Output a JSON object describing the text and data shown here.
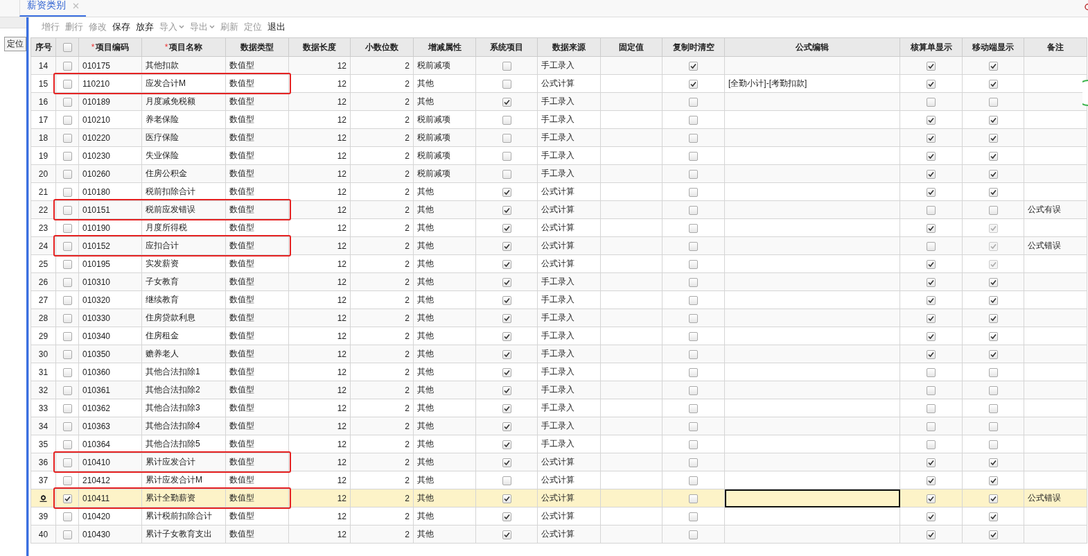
{
  "tabs": [
    {
      "label": "薪资类别",
      "selected": true,
      "closable": true
    }
  ],
  "side_panel": {
    "button": "定位"
  },
  "toolbar": [
    {
      "label": "增行",
      "disabled": true,
      "dropdown": false
    },
    {
      "label": "删行",
      "disabled": true,
      "dropdown": false
    },
    {
      "label": "修改",
      "disabled": true,
      "dropdown": false
    },
    {
      "label": "保存",
      "disabled": false,
      "dropdown": false
    },
    {
      "label": "放弃",
      "disabled": false,
      "dropdown": false
    },
    {
      "label": "导入",
      "disabled": true,
      "dropdown": true
    },
    {
      "label": "导出",
      "disabled": true,
      "dropdown": true
    },
    {
      "label": "刷新",
      "disabled": true,
      "dropdown": false
    },
    {
      "label": "定位",
      "disabled": true,
      "dropdown": false
    },
    {
      "label": "退出",
      "disabled": false,
      "dropdown": false
    }
  ],
  "table": {
    "header_checked": false,
    "columns": [
      {
        "label": "序号"
      },
      {
        "kind": "checkbox"
      },
      {
        "marker": "*",
        "label": "项目编码"
      },
      {
        "marker": "*",
        "label": "项目名称"
      },
      {
        "label": "数据类型"
      },
      {
        "label": "数据长度"
      },
      {
        "label": "小数位数"
      },
      {
        "label": "增减属性"
      },
      {
        "label": "系统项目"
      },
      {
        "label": "数据来源"
      },
      {
        "label": "固定值"
      },
      {
        "label": "复制时清空"
      },
      {
        "label": "公式编辑"
      },
      {
        "label": "核算单显示"
      },
      {
        "label": "移动端显示"
      },
      {
        "label": "备注"
      }
    ],
    "rows": [
      {
        "seq": "14",
        "checked": false,
        "selected": false,
        "code": "010175",
        "name": "其他扣款",
        "type": "数值型",
        "length": "12",
        "decimals": "2",
        "attr": "税前减项",
        "system": false,
        "source": "手工录入",
        "clear": true,
        "account": true,
        "mobile": true,
        "mobile_disabled": false,
        "editing": false
      },
      {
        "seq": "15",
        "checked": false,
        "selected": false,
        "code": "110210",
        "name": "应发合计M",
        "type": "数值型",
        "length": "12",
        "decimals": "2",
        "attr": "其他",
        "system": false,
        "source": "公式计算",
        "clear": true,
        "formula": "[全勤小计]-[考勤扣款]",
        "account": true,
        "mobile": true,
        "mobile_disabled": false,
        "editing": false,
        "flagged": true
      },
      {
        "seq": "16",
        "checked": false,
        "selected": false,
        "code": "010189",
        "name": "月度减免税额",
        "type": "数值型",
        "length": "12",
        "decimals": "2",
        "attr": "其他",
        "system": true,
        "source": "手工录入",
        "clear": false,
        "account": false,
        "mobile": false,
        "mobile_disabled": false,
        "editing": false
      },
      {
        "seq": "17",
        "checked": false,
        "selected": false,
        "code": "010210",
        "name": "养老保险",
        "type": "数值型",
        "length": "12",
        "decimals": "2",
        "attr": "税前减项",
        "system": false,
        "source": "手工录入",
        "clear": false,
        "account": true,
        "mobile": true,
        "mobile_disabled": false,
        "editing": false
      },
      {
        "seq": "18",
        "checked": false,
        "selected": false,
        "code": "010220",
        "name": "医疗保险",
        "type": "数值型",
        "length": "12",
        "decimals": "2",
        "attr": "税前减项",
        "system": false,
        "source": "手工录入",
        "clear": false,
        "account": true,
        "mobile": true,
        "mobile_disabled": false,
        "editing": false
      },
      {
        "seq": "19",
        "checked": false,
        "selected": false,
        "code": "010230",
        "name": "失业保险",
        "type": "数值型",
        "length": "12",
        "decimals": "2",
        "attr": "税前减项",
        "system": false,
        "source": "手工录入",
        "clear": false,
        "account": true,
        "mobile": true,
        "mobile_disabled": false,
        "editing": false
      },
      {
        "seq": "20",
        "checked": false,
        "selected": false,
        "code": "010260",
        "name": "住房公积金",
        "type": "数值型",
        "length": "12",
        "decimals": "2",
        "attr": "税前减项",
        "system": false,
        "source": "手工录入",
        "clear": false,
        "account": true,
        "mobile": true,
        "mobile_disabled": false,
        "editing": false
      },
      {
        "seq": "21",
        "checked": false,
        "selected": false,
        "code": "010180",
        "name": "税前扣除合计",
        "type": "数值型",
        "length": "12",
        "decimals": "2",
        "attr": "其他",
        "system": true,
        "source": "公式计算",
        "clear": false,
        "account": true,
        "mobile": true,
        "mobile_disabled": false,
        "editing": false
      },
      {
        "seq": "22",
        "checked": false,
        "selected": false,
        "code": "010151",
        "name": "税前应发错误",
        "type": "数值型",
        "length": "12",
        "decimals": "2",
        "attr": "其他",
        "system": true,
        "source": "公式计算",
        "clear": false,
        "account": false,
        "mobile": false,
        "mobile_disabled": false,
        "editing": false,
        "note": "公式有误",
        "flagged": true
      },
      {
        "seq": "23",
        "checked": false,
        "selected": false,
        "code": "010190",
        "name": "月度所得税",
        "type": "数值型",
        "length": "12",
        "decimals": "2",
        "attr": "其他",
        "system": true,
        "source": "公式计算",
        "clear": false,
        "account": true,
        "mobile": true,
        "mobile_disabled": true,
        "editing": false
      },
      {
        "seq": "24",
        "checked": false,
        "selected": false,
        "code": "010152",
        "name": "应扣合计",
        "type": "数值型",
        "length": "12",
        "decimals": "2",
        "attr": "其他",
        "system": true,
        "source": "公式计算",
        "clear": false,
        "account": false,
        "mobile": true,
        "mobile_disabled": true,
        "editing": false,
        "note": "公式错误",
        "flagged": true
      },
      {
        "seq": "25",
        "checked": false,
        "selected": false,
        "code": "010195",
        "name": "实发薪资",
        "type": "数值型",
        "length": "12",
        "decimals": "2",
        "attr": "其他",
        "system": true,
        "source": "公式计算",
        "clear": false,
        "account": true,
        "mobile": true,
        "mobile_disabled": true,
        "editing": false
      },
      {
        "seq": "26",
        "checked": false,
        "selected": false,
        "code": "010310",
        "name": "子女教育",
        "type": "数值型",
        "length": "12",
        "decimals": "2",
        "attr": "其他",
        "system": true,
        "source": "手工录入",
        "clear": false,
        "account": true,
        "mobile": true,
        "mobile_disabled": false,
        "editing": false
      },
      {
        "seq": "27",
        "checked": false,
        "selected": false,
        "code": "010320",
        "name": "继续教育",
        "type": "数值型",
        "length": "12",
        "decimals": "2",
        "attr": "其他",
        "system": true,
        "source": "手工录入",
        "clear": false,
        "account": true,
        "mobile": true,
        "mobile_disabled": false,
        "editing": false
      },
      {
        "seq": "28",
        "checked": false,
        "selected": false,
        "code": "010330",
        "name": "住房贷款利息",
        "type": "数值型",
        "length": "12",
        "decimals": "2",
        "attr": "其他",
        "system": true,
        "source": "手工录入",
        "clear": false,
        "account": true,
        "mobile": true,
        "mobile_disabled": false,
        "editing": false
      },
      {
        "seq": "29",
        "checked": false,
        "selected": false,
        "code": "010340",
        "name": "住房租金",
        "type": "数值型",
        "length": "12",
        "decimals": "2",
        "attr": "其他",
        "system": true,
        "source": "手工录入",
        "clear": false,
        "account": true,
        "mobile": true,
        "mobile_disabled": false,
        "editing": false
      },
      {
        "seq": "30",
        "checked": false,
        "selected": false,
        "code": "010350",
        "name": "赡养老人",
        "type": "数值型",
        "length": "12",
        "decimals": "2",
        "attr": "其他",
        "system": true,
        "source": "手工录入",
        "clear": false,
        "account": true,
        "mobile": true,
        "mobile_disabled": false,
        "editing": false
      },
      {
        "seq": "31",
        "checked": false,
        "selected": false,
        "code": "010360",
        "name": "其他合法扣除1",
        "type": "数值型",
        "length": "12",
        "decimals": "2",
        "attr": "其他",
        "system": true,
        "source": "手工录入",
        "clear": false,
        "account": false,
        "mobile": false,
        "mobile_disabled": false,
        "editing": false
      },
      {
        "seq": "32",
        "checked": false,
        "selected": false,
        "code": "010361",
        "name": "其他合法扣除2",
        "type": "数值型",
        "length": "12",
        "decimals": "2",
        "attr": "其他",
        "system": true,
        "source": "手工录入",
        "clear": false,
        "account": false,
        "mobile": false,
        "mobile_disabled": false,
        "editing": false
      },
      {
        "seq": "33",
        "checked": false,
        "selected": false,
        "code": "010362",
        "name": "其他合法扣除3",
        "type": "数值型",
        "length": "12",
        "decimals": "2",
        "attr": "其他",
        "system": true,
        "source": "手工录入",
        "clear": false,
        "account": false,
        "mobile": false,
        "mobile_disabled": false,
        "editing": false
      },
      {
        "seq": "34",
        "checked": false,
        "selected": false,
        "code": "010363",
        "name": "其他合法扣除4",
        "type": "数值型",
        "length": "12",
        "decimals": "2",
        "attr": "其他",
        "system": true,
        "source": "手工录入",
        "clear": false,
        "account": false,
        "mobile": false,
        "mobile_disabled": false,
        "editing": false
      },
      {
        "seq": "35",
        "checked": false,
        "selected": false,
        "code": "010364",
        "name": "其他合法扣除5",
        "type": "数值型",
        "length": "12",
        "decimals": "2",
        "attr": "其他",
        "system": true,
        "source": "手工录入",
        "clear": false,
        "account": false,
        "mobile": false,
        "mobile_disabled": false,
        "editing": false
      },
      {
        "seq": "36",
        "checked": false,
        "selected": false,
        "code": "010410",
        "name": "累计应发合计",
        "type": "数值型",
        "length": "12",
        "decimals": "2",
        "attr": "其他",
        "system": true,
        "source": "公式计算",
        "clear": false,
        "account": true,
        "mobile": true,
        "mobile_disabled": false,
        "editing": false,
        "flagged": true
      },
      {
        "seq": "37",
        "checked": false,
        "selected": false,
        "code": "210412",
        "name": "累计应发合计M",
        "type": "数值型",
        "length": "12",
        "decimals": "2",
        "attr": "其他",
        "system": false,
        "source": "公式计算",
        "clear": false,
        "account": true,
        "mobile": true,
        "mobile_disabled": false,
        "editing": false
      },
      {
        "checked": true,
        "selected": true,
        "code": "010411",
        "name": "累计全勤薪资",
        "type": "数值型",
        "length": "12",
        "decimals": "2",
        "attr": "其他",
        "system": true,
        "source": "公式计算",
        "clear": false,
        "account": true,
        "mobile": true,
        "mobile_disabled": false,
        "editing": true,
        "note": "公式错误",
        "flagged": true
      },
      {
        "seq": "39",
        "checked": false,
        "selected": false,
        "code": "010420",
        "name": "累计税前扣除合计",
        "type": "数值型",
        "length": "12",
        "decimals": "2",
        "attr": "其他",
        "system": true,
        "source": "公式计算",
        "clear": false,
        "account": true,
        "mobile": true,
        "mobile_disabled": false,
        "editing": false
      },
      {
        "seq": "40",
        "checked": false,
        "selected": false,
        "code": "010430",
        "name": "累计子女教育支出",
        "type": "数值型",
        "length": "12",
        "decimals": "2",
        "attr": "其他",
        "system": true,
        "source": "公式计算",
        "clear": false,
        "account": true,
        "mobile": true,
        "mobile_disabled": false,
        "editing": false
      }
    ]
  }
}
